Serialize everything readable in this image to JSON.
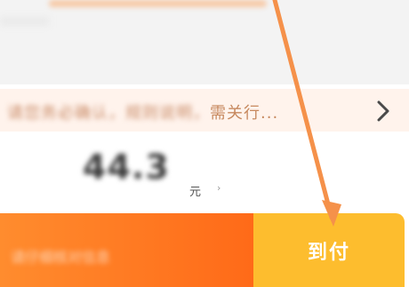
{
  "notice": {
    "blurred_text": "请您务必确认，规则说明，",
    "visible_text": "需关行..."
  },
  "order": {
    "price": "44.3",
    "unit": "元"
  },
  "bottom_bar": {
    "left_text": "请仔细核对信息",
    "pay_label": "到付"
  },
  "colors": {
    "bottom_left_gradient": [
      "#ff8c2e",
      "#ff6a18"
    ],
    "pay_button": "#fdbd2e",
    "arrow": "#f5914a"
  },
  "icons": {
    "notice_chevron": "chevron-right-icon",
    "annotation_arrow": "arrow-annotation"
  }
}
